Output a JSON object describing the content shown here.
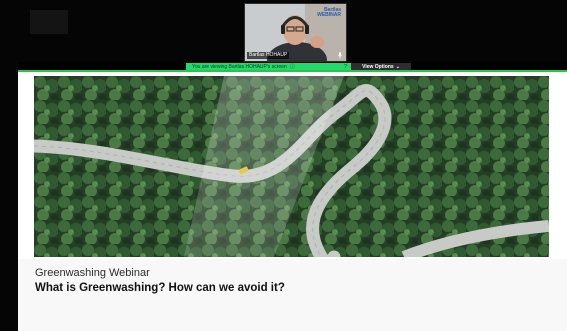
{
  "meeting": {
    "participant_name": "Bartlas HOHAUP",
    "video_logo_line1": "Bartlas",
    "video_logo_line2": "WEBINAR",
    "mic_icon": "microphone-icon",
    "share_banner": {
      "text": "You are viewing Bartlas HOHAUP's screen",
      "info_icon": "info-icon",
      "help_label": "?",
      "color": "#23d96b"
    },
    "view_options": {
      "label": "View Options",
      "chevron": "⌄",
      "icon": "chevron-down-icon"
    }
  },
  "slide": {
    "kicker": "Greenwashing Webinar",
    "title": "What is Greenwashing? How can we avoid it?",
    "accent_color": "#2bc34a"
  }
}
